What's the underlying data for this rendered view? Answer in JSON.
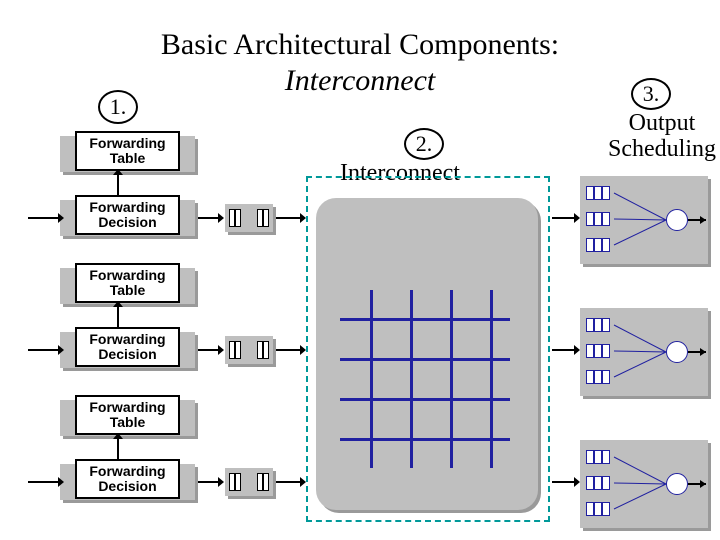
{
  "title": "Basic Architectural Components:",
  "subtitle": "Interconnect",
  "markers": {
    "m1": "1.",
    "m2": "2.",
    "m3": "3."
  },
  "labels": {
    "interconnect": "Interconnect",
    "output_scheduling_l1": "Output",
    "output_scheduling_l2": "Scheduling"
  },
  "left_column": {
    "pairs": [
      {
        "table": "Forwarding\nTable",
        "decision": "Forwarding\nDecision"
      },
      {
        "table": "Forwarding\nTable",
        "decision": "Forwarding\nDecision"
      },
      {
        "table": "Forwarding\nTable",
        "decision": "Forwarding\nDecision"
      }
    ]
  },
  "chart_data": {
    "type": "diagram",
    "stages": [
      {
        "id": 1,
        "name": "Forwarding Table / Decision",
        "count": 3
      },
      {
        "id": 2,
        "name": "Interconnect (crossbar)",
        "inputs": 3,
        "outputs": 3
      },
      {
        "id": 3,
        "name": "Output Scheduling",
        "ports": 3,
        "queues_per_port": 3
      }
    ]
  }
}
